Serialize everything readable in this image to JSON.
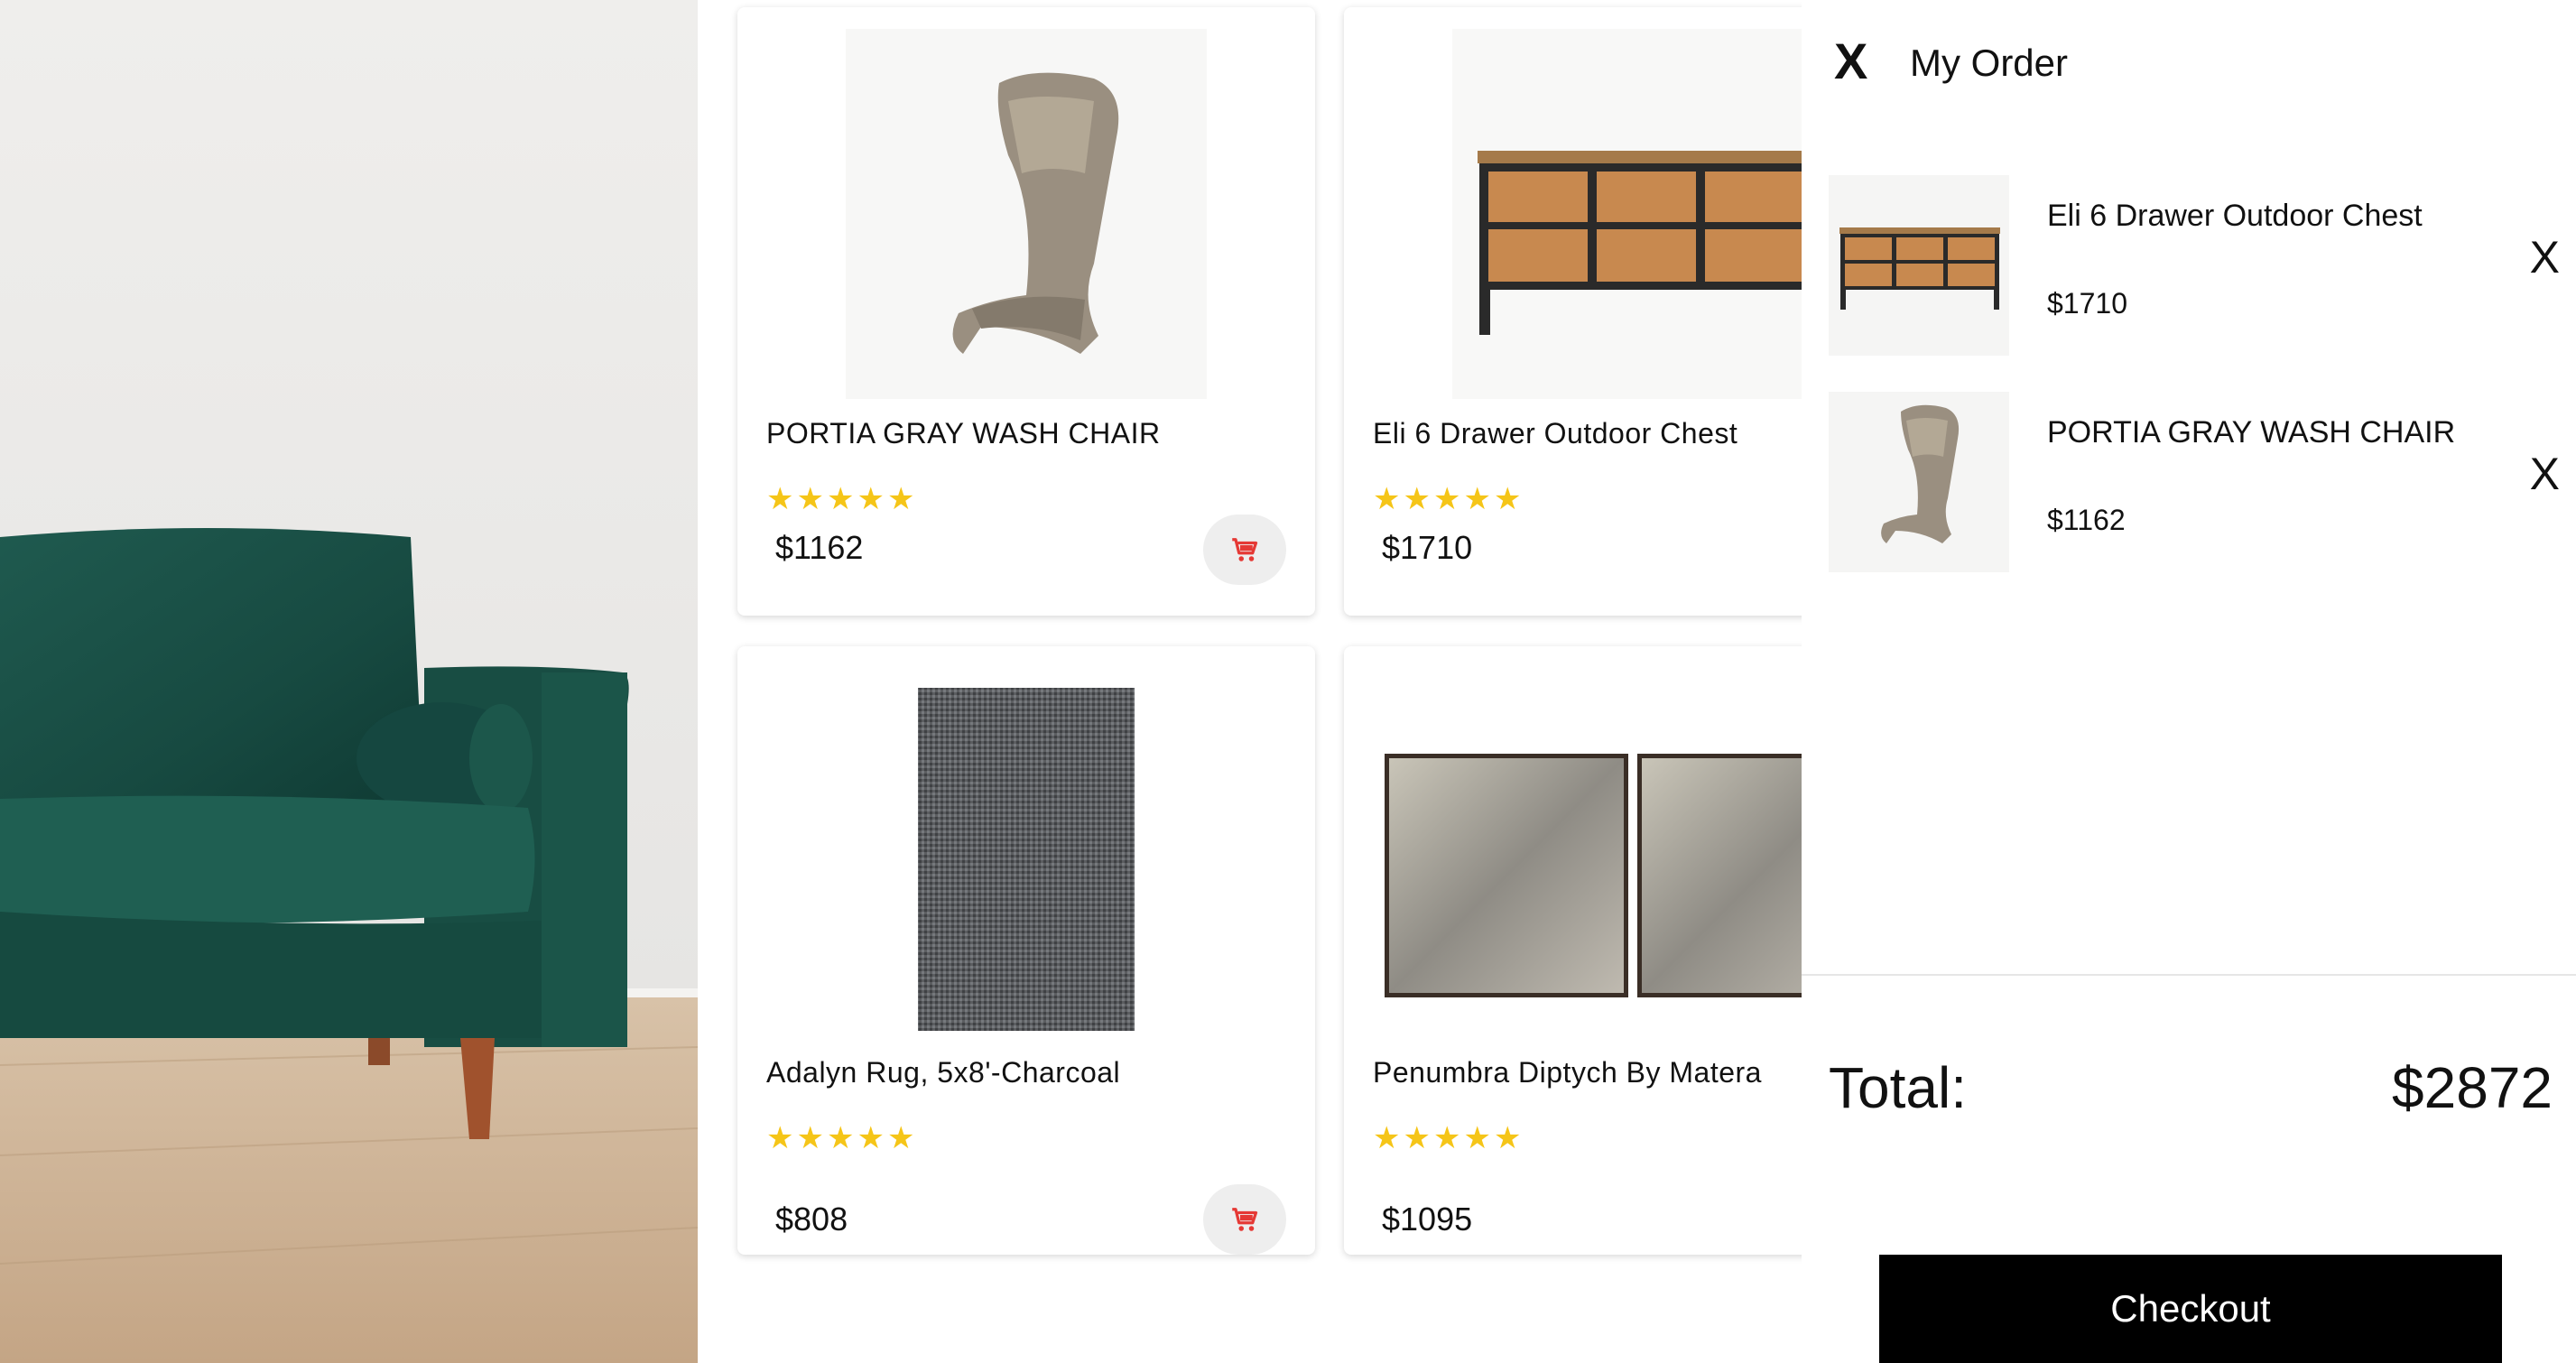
{
  "colors": {
    "star": "#f5c518",
    "cart_icon": "#e53935",
    "checkout_bg": "#000000",
    "checkout_text": "#ffffff"
  },
  "products": [
    {
      "name": "PORTIA GRAY WASH CHAIR",
      "rating": 5,
      "price": "$1162"
    },
    {
      "name": "Eli 6 Drawer Outdoor Chest",
      "rating": 5,
      "price": "$1710"
    },
    {
      "name": "Adalyn Rug, 5x8'-Charcoal",
      "rating": 5,
      "price": "$808"
    },
    {
      "name": "Penumbra Diptych By Matera",
      "rating": 5,
      "price": "$1095"
    }
  ],
  "cart": {
    "close_label": "X",
    "title": "My Order",
    "items": [
      {
        "name": "Eli 6 Drawer Outdoor Chest",
        "price": "$1710",
        "remove_label": "X"
      },
      {
        "name": "PORTIA GRAY WASH CHAIR",
        "price": "$1162",
        "remove_label": "X"
      }
    ],
    "total_label": "Total:",
    "total_value": "$2872",
    "checkout_label": "Checkout"
  },
  "icons": {
    "cart": "shopping-cart-icon",
    "star": "star-icon",
    "close": "close-icon"
  }
}
